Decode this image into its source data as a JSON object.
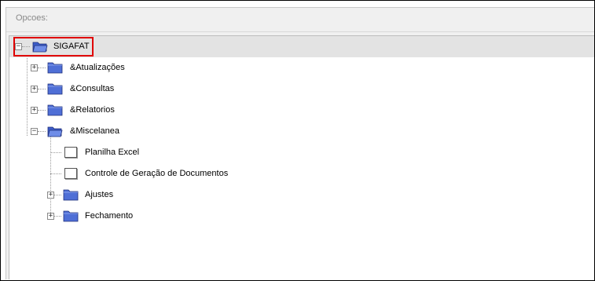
{
  "panel": {
    "title": "Opcoes:"
  },
  "tree": {
    "root": {
      "label": "SIGAFAT",
      "expander": "−",
      "selected": true,
      "highlighted": true
    },
    "items": [
      {
        "label": "&Atualizações",
        "expander": "+",
        "icon": "folder-closed-icon"
      },
      {
        "label": "&Consultas",
        "expander": "+",
        "icon": "folder-closed-icon"
      },
      {
        "label": "&Relatorios",
        "expander": "+",
        "icon": "folder-closed-icon"
      },
      {
        "label": "&Miscelanea",
        "expander": "−",
        "icon": "folder-open-icon"
      }
    ],
    "miscelanea_children": [
      {
        "label": "Planilha Excel",
        "icon": "document-icon"
      },
      {
        "label": "Controle de Geração de Documentos",
        "icon": "document-icon"
      },
      {
        "label": "Ajustes",
        "expander": "+",
        "icon": "folder-closed-icon"
      },
      {
        "label": "Fechamento",
        "expander": "+",
        "icon": "folder-closed-icon"
      }
    ]
  },
  "colors": {
    "folder_fill": "#4f6fd6",
    "folder_tab": "#6f8de8",
    "highlight_border": "#e00000",
    "selected_row": "#e3e3e3"
  }
}
